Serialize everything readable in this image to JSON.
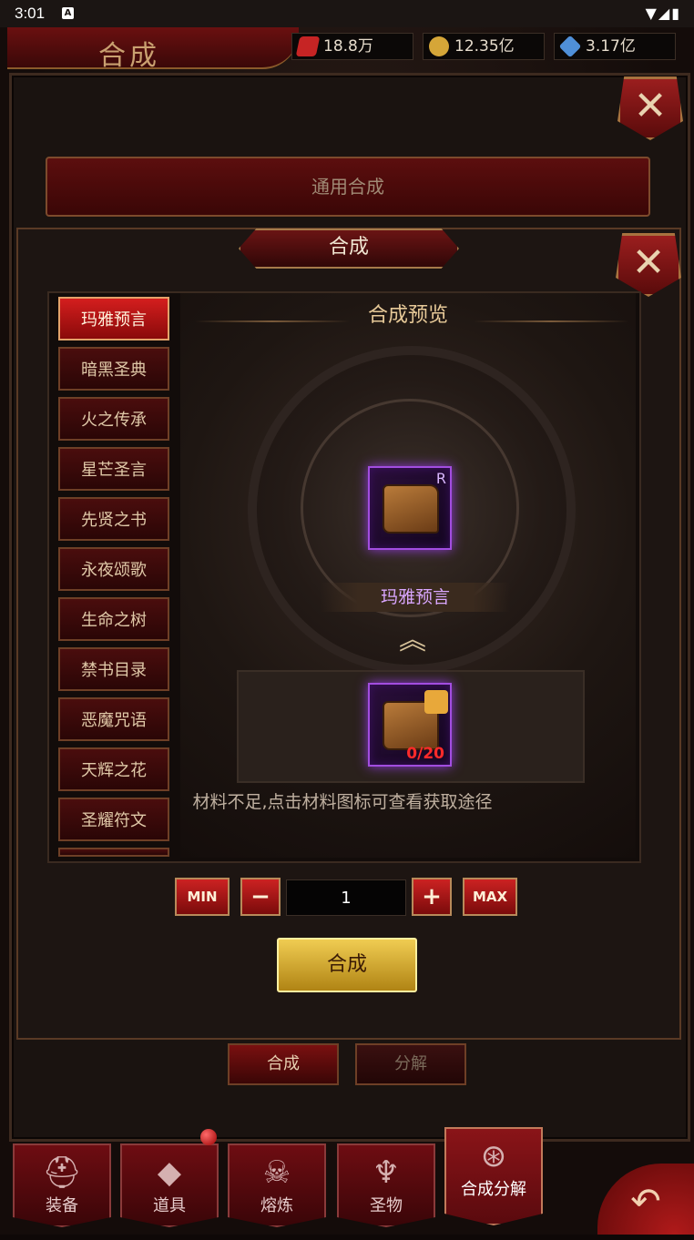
{
  "status_bar": {
    "time": "3:01",
    "notification_badge": "A",
    "icons": "▼◢▮"
  },
  "header": {
    "title": "合成"
  },
  "resources": [
    {
      "icon": "red-card-icon",
      "value": "18.8万",
      "color": "#c62424"
    },
    {
      "icon": "gold-coin-icon",
      "value": "12.35亿",
      "color": "#d5a638"
    },
    {
      "icon": "diamond-icon",
      "value": "3.17亿",
      "color": "#4f8fd8"
    }
  ],
  "outer_panel": {
    "close_label": "✕",
    "general_tab": "通用合成"
  },
  "inner_panel": {
    "title": "合成",
    "close_label": "✕",
    "list": [
      "玛雅预言",
      "暗黑圣典",
      "火之传承",
      "星芒圣言",
      "先贤之书",
      "永夜颂歌",
      "生命之树",
      "禁书目录",
      "恶魔咒语",
      "天辉之花",
      "圣耀符文"
    ],
    "selected_index": 0,
    "preview": {
      "title": "合成预览",
      "result_name": "玛雅预言",
      "rarity": "R",
      "material_count": "0/20",
      "up_arrow": "︽",
      "hint": "材料不足,点击材料图标可查看获取途径"
    },
    "quantity": {
      "min_label": "MIN",
      "minus_label": "−",
      "value": "1",
      "plus_label": "+",
      "max_label": "MAX"
    },
    "craft_button": "合成"
  },
  "sub_tabs": [
    "合成",
    "分解"
  ],
  "bottom_nav": [
    {
      "label": "装备",
      "icon": "helmet-icon",
      "glyph": "⛑"
    },
    {
      "label": "道具",
      "icon": "crystal-icon",
      "glyph": "◆"
    },
    {
      "label": "熔炼",
      "icon": "skull-icon",
      "glyph": "☠"
    },
    {
      "label": "圣物",
      "icon": "demon-icon",
      "glyph": "♆"
    },
    {
      "label": "合成分解",
      "icon": "orb-icon",
      "glyph": "⊛"
    }
  ],
  "back_button": "↶"
}
